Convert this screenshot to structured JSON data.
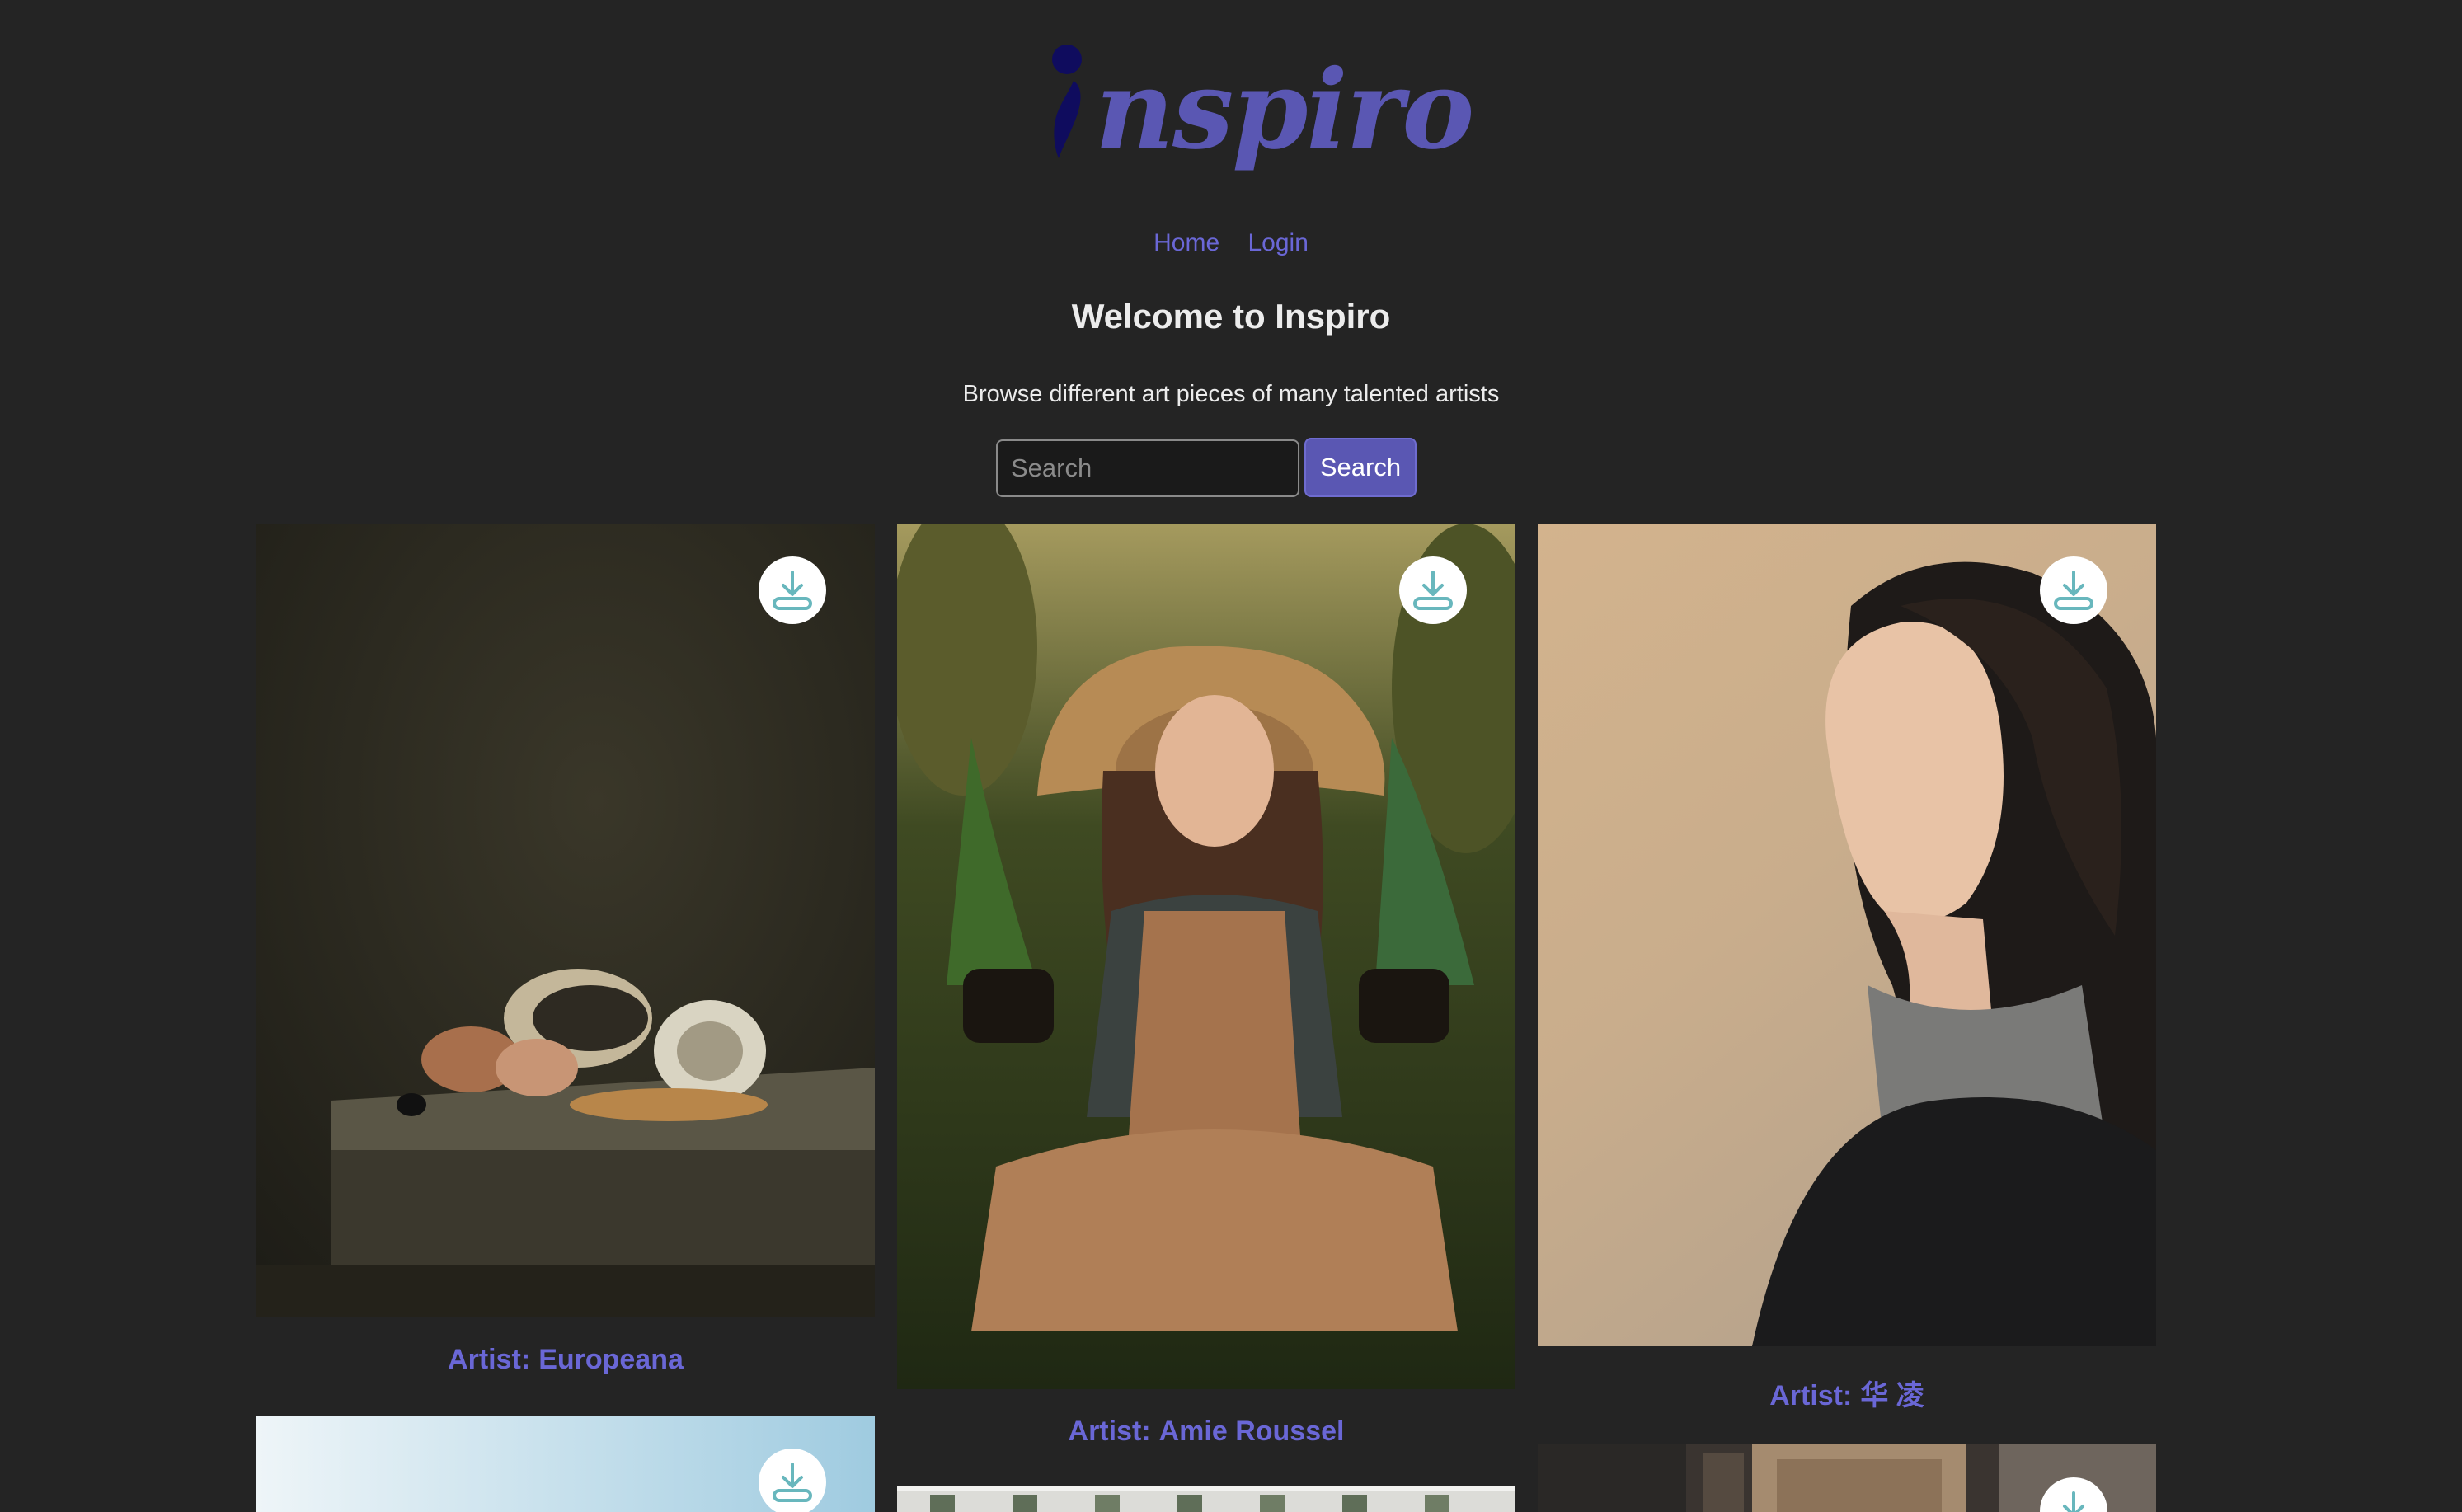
{
  "brand": {
    "name": "nspiro",
    "logo_color": "#5a57b3",
    "logo_mark_color": "#0f0c5e"
  },
  "nav": {
    "home_label": "Home",
    "login_label": "Login"
  },
  "hero": {
    "title": "Welcome to Inspiro",
    "subtitle": "Browse different art pieces of many talented artists"
  },
  "search": {
    "placeholder": "Search",
    "value": "",
    "button_label": "Search"
  },
  "gallery": {
    "artist_prefix": "Artist:",
    "download_icon": "download-icon",
    "cards": [
      {
        "artist": "Europeana",
        "image": "still-life-seashells-painting"
      },
      {
        "artist": "Amie Roussel",
        "image": "woman-in-straw-hat-holding-plants"
      },
      {
        "artist": "华 凌",
        "image": "woman-portrait-by-water"
      },
      {
        "artist": "",
        "image": "light-sky-gradient"
      },
      {
        "artist": "",
        "image": "white-building-facade"
      },
      {
        "artist": "",
        "image": "aerial-city-buildings"
      }
    ]
  },
  "colors": {
    "background": "#242424",
    "accent": "#5a57b3",
    "link": "#6a67d6",
    "download_icon": "#68b7bd"
  }
}
